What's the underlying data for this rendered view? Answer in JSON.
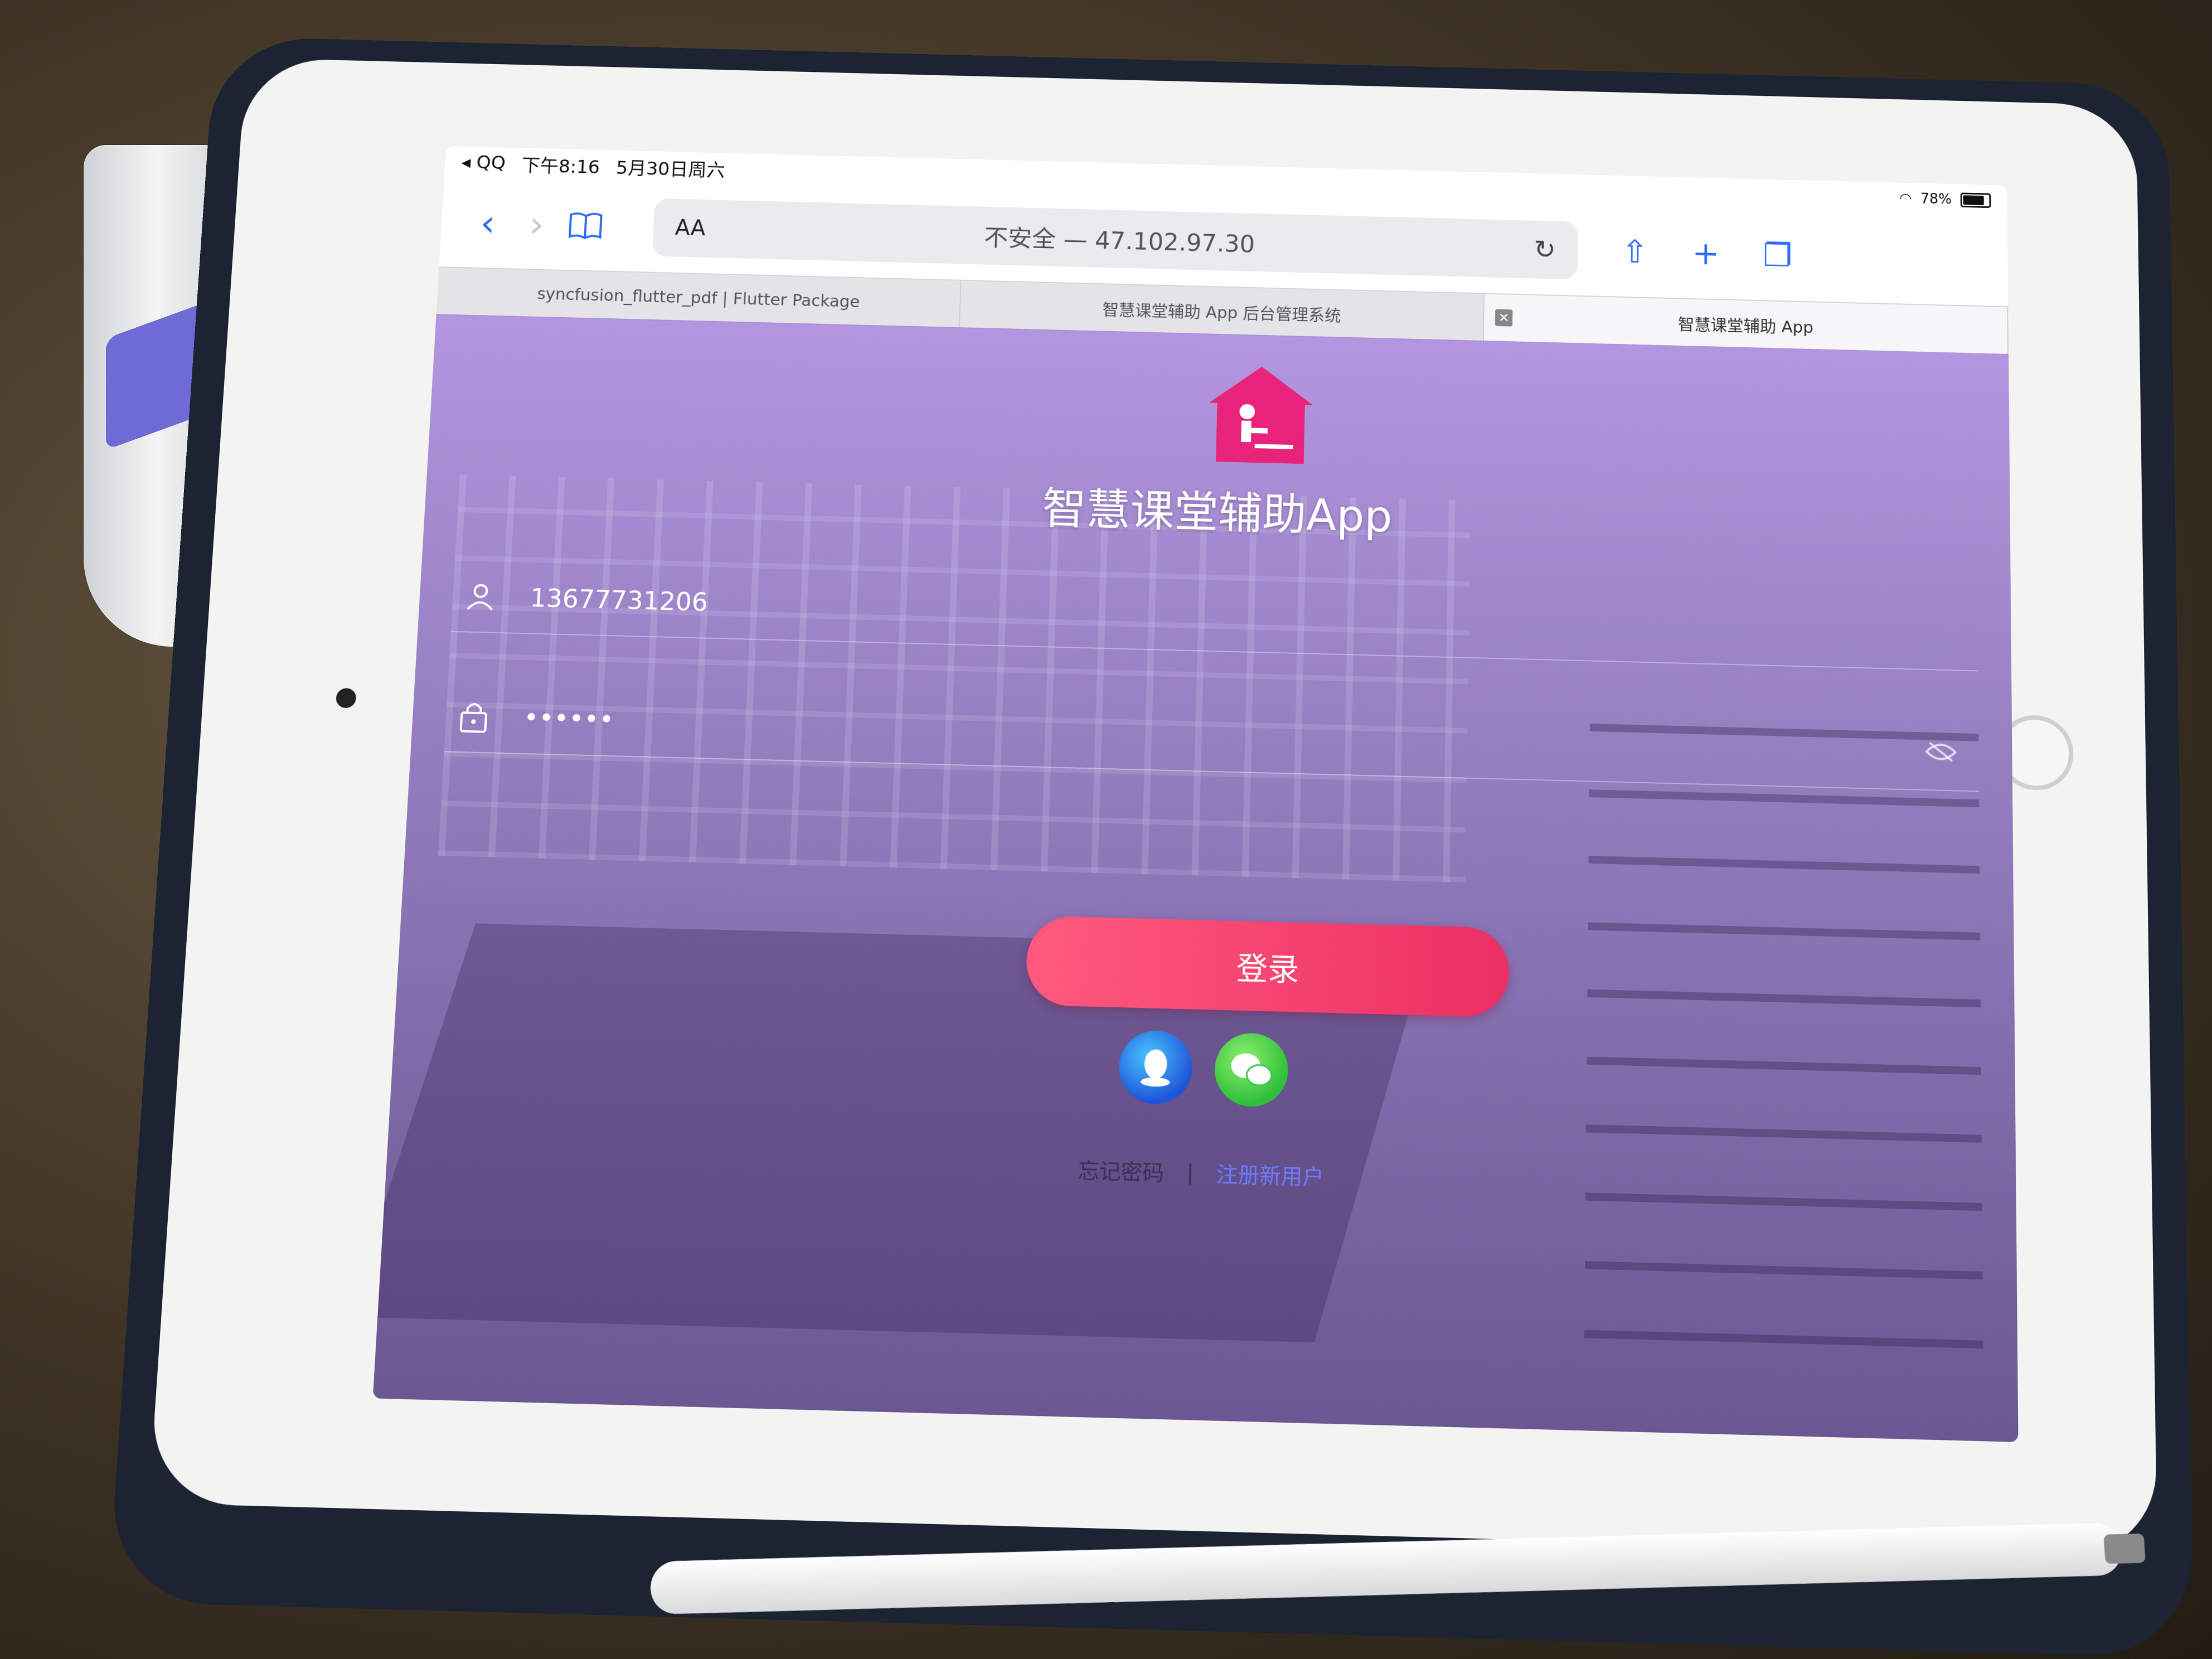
{
  "statusbar": {
    "back_app": "◂ QQ",
    "time": "下午8:16",
    "date": "5月30日周六",
    "battery": "78%"
  },
  "browser": {
    "text_size_label": "AA",
    "url_text": "不安全 — 47.102.97.30",
    "tabs": [
      {
        "label": "syncfusion_flutter_pdf | Flutter Package",
        "active": false
      },
      {
        "label": "智慧课堂辅助 App 后台管理系统",
        "active": false
      },
      {
        "label": "智慧课堂辅助 App",
        "active": true
      }
    ]
  },
  "login": {
    "app_title": "智慧课堂辅助App",
    "username_value": "13677731206",
    "password_value": "••••••",
    "login_button": "登录",
    "forgot_link": "忘记密码",
    "separator": "|",
    "register_link": "注册新用户"
  },
  "colors": {
    "accent": "#ec2f63",
    "logo": "#e8247a",
    "link": "#6c7bff"
  },
  "icons": {
    "user": "user-icon",
    "lock": "lock-icon",
    "eye": "eye-off-icon",
    "qq": "qq-icon",
    "wechat": "wechat-icon"
  }
}
